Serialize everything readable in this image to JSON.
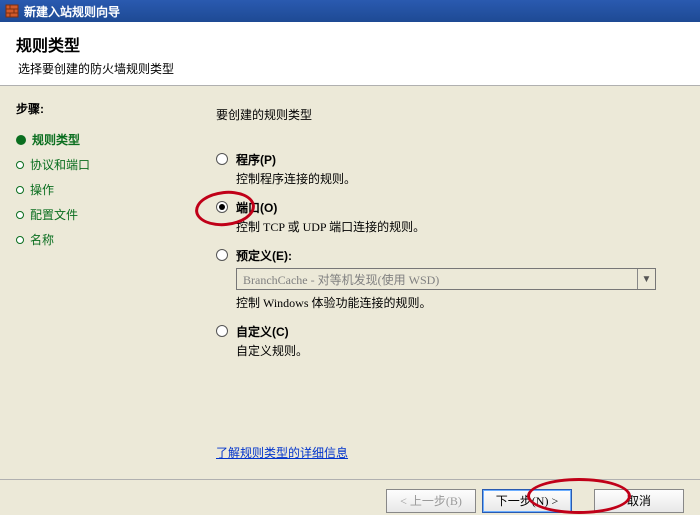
{
  "window": {
    "title": "新建入站规则向导"
  },
  "header": {
    "title": "规则类型",
    "desc": "选择要创建的防火墙规则类型"
  },
  "sidebar": {
    "heading": "步骤:",
    "items": [
      {
        "label": "规则类型",
        "active": true
      },
      {
        "label": "协议和端口",
        "active": false
      },
      {
        "label": "操作",
        "active": false
      },
      {
        "label": "配置文件",
        "active": false
      },
      {
        "label": "名称",
        "active": false
      }
    ]
  },
  "main": {
    "prompt": "要创建的规则类型",
    "options": {
      "program": {
        "label": "程序(P)",
        "desc": "控制程序连接的规则。"
      },
      "port": {
        "label": "端口(O)",
        "desc": "控制 TCP 或 UDP 端口连接的规则。"
      },
      "predefined": {
        "label": "预定义(E):",
        "desc": "控制 Windows 体验功能连接的规则。",
        "combo": "BranchCache - 对等机发现(使用 WSD)"
      },
      "custom": {
        "label": "自定义(C)",
        "desc": "自定义规则。"
      }
    },
    "help_link": "了解规则类型的详细信息"
  },
  "footer": {
    "back": "< 上一步(B)",
    "next": "下一步(N) >",
    "cancel": "取消"
  }
}
